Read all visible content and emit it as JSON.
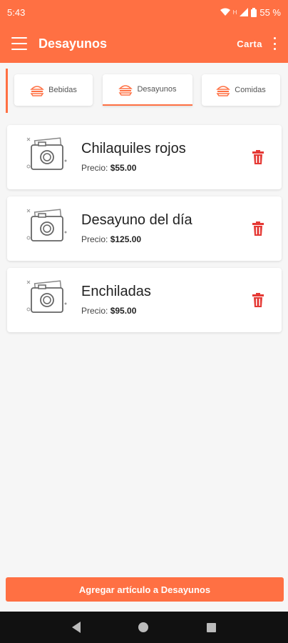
{
  "status": {
    "time": "5:43",
    "indicator": "H",
    "battery": "55 %"
  },
  "toolbar": {
    "title": "Desayunos",
    "action_label": "Carta"
  },
  "tabs": [
    {
      "label": "Bebidas",
      "icon": "burger-icon",
      "active": false
    },
    {
      "label": "Desayunos",
      "icon": "burger-icon",
      "active": true
    },
    {
      "label": "Comidas",
      "icon": "burger-icon",
      "active": false
    }
  ],
  "items": [
    {
      "name": "Chilaquiles rojos",
      "price_label": "Precio:",
      "price": "$55.00"
    },
    {
      "name": "Desayuno del día",
      "price_label": "Precio:",
      "price": "$125.00"
    },
    {
      "name": "Enchiladas",
      "price_label": "Precio:",
      "price": "$95.00"
    }
  ],
  "add_button": {
    "label": "Agregar artículo a Desayunos"
  },
  "colors": {
    "accent": "#ff7043",
    "delete": "#e53935",
    "navbar": "#111111"
  }
}
